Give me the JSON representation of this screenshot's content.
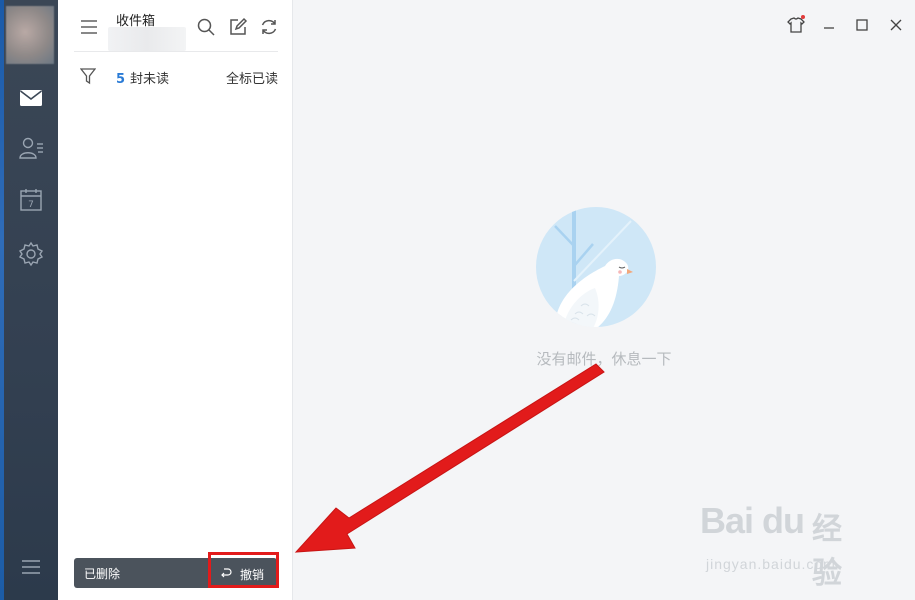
{
  "sidebar": {
    "items": [
      {
        "icon": "mail-icon",
        "active": true
      },
      {
        "icon": "contacts-icon",
        "active": false
      },
      {
        "icon": "calendar-icon",
        "active": false,
        "calendar_day": "7"
      },
      {
        "icon": "gear-icon",
        "active": false
      }
    ]
  },
  "list": {
    "folder_title": "收件箱",
    "unread_count": "5",
    "unread_label": "封未读",
    "mark_all_read": "全标已读"
  },
  "toast": {
    "message": "已删除",
    "undo_label": "撤销"
  },
  "main": {
    "empty_text": "没有邮件，休息一下"
  },
  "watermark": {
    "logo_text": "Bai du",
    "cn_text": "经验",
    "url": "jingyan.baidu.com"
  },
  "colors": {
    "accent_blue": "#2a7bd6",
    "annotation_red": "#e21b1b",
    "sidebar_bg": "#3b4756"
  }
}
